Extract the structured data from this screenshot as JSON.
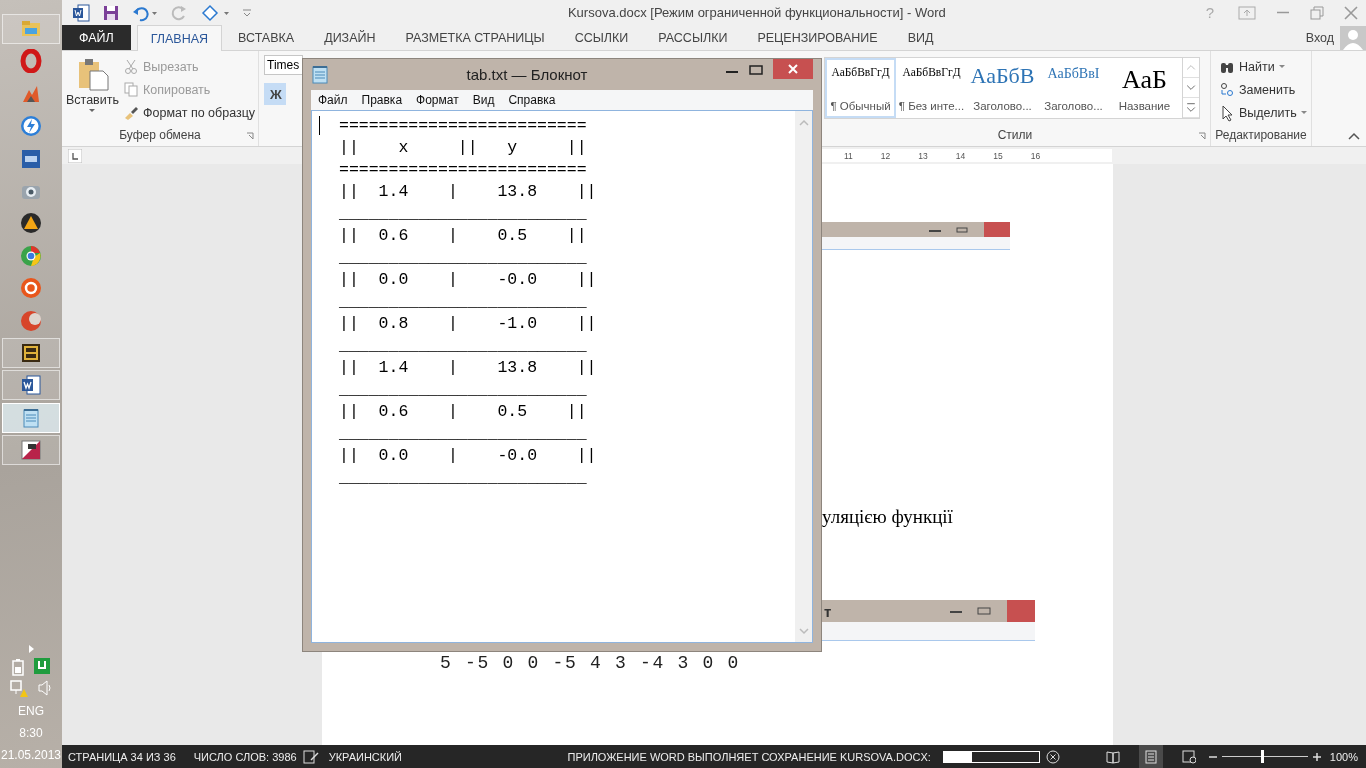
{
  "taskbar": {
    "items": [
      {
        "kind": "folder",
        "running": true,
        "selected": false
      },
      {
        "kind": "ring",
        "running": false,
        "selected": false
      },
      {
        "kind": "flame",
        "running": false,
        "selected": false
      },
      {
        "kind": "bolt",
        "running": false,
        "selected": false
      },
      {
        "kind": "tile",
        "running": false,
        "selected": false
      },
      {
        "kind": "camera",
        "running": false,
        "selected": false
      },
      {
        "kind": "triangle",
        "running": false,
        "selected": false
      },
      {
        "kind": "wheel",
        "running": false,
        "selected": false
      },
      {
        "kind": "swirl",
        "running": false,
        "selected": false
      },
      {
        "kind": "crescent",
        "running": false,
        "selected": false
      },
      {
        "kind": "box",
        "running": true,
        "selected": false
      },
      {
        "kind": "document",
        "running": true,
        "selected": false
      },
      {
        "kind": "notepad",
        "running": true,
        "selected": true
      },
      {
        "kind": "editor",
        "running": true,
        "selected": false
      }
    ],
    "tray": {
      "language": "ENG",
      "time": "8:30",
      "date": "21.05.2013"
    }
  },
  "word": {
    "title": "Kursova.docx [Режим ограниченной функциональности] - Word",
    "help_button": "?",
    "tabs": [
      {
        "label": "ФАЙЛ",
        "kind": "file",
        "selected": false
      },
      {
        "label": "ГЛАВНАЯ",
        "kind": "tab",
        "selected": true
      },
      {
        "label": "ВСТАВКА",
        "kind": "tab",
        "selected": false
      },
      {
        "label": "ДИЗАЙН",
        "kind": "tab",
        "selected": false
      },
      {
        "label": "РАЗМЕТКА СТРАНИЦЫ",
        "kind": "tab",
        "selected": false
      },
      {
        "label": "ССЫЛКИ",
        "kind": "tab",
        "selected": false
      },
      {
        "label": "РАССЫЛКИ",
        "kind": "tab",
        "selected": false
      },
      {
        "label": "РЕЦЕНЗИРОВАНИЕ",
        "kind": "tab",
        "selected": false
      },
      {
        "label": "ВИД",
        "kind": "tab",
        "selected": false
      }
    ],
    "account": "Вход",
    "ribbon": {
      "clipboard": {
        "paste": "Вставить",
        "title": "Буфер обмена",
        "items": [
          {
            "label": "Вырезать",
            "kind": "cut",
            "disabled": true
          },
          {
            "label": "Копировать",
            "kind": "copy",
            "disabled": true
          },
          {
            "label": "Формат по образцу",
            "kind": "brush",
            "disabled": false
          }
        ]
      },
      "font": {
        "name": "Times",
        "bold": {
          "label": "Ж",
          "selected": true
        }
      },
      "styles": {
        "title": "Стили",
        "items": [
          {
            "sample": "АаБбВвГгД",
            "label": "¶ Обычный",
            "kind": "body",
            "selected": true
          },
          {
            "sample": "АаБбВвГгД",
            "label": "¶ Без инте...",
            "kind": "body",
            "selected": false
          },
          {
            "sample": "АаБбВ",
            "label": "Заголово...",
            "kind": "heading1",
            "selected": false
          },
          {
            "sample": "АаБбВвI",
            "label": "Заголово...",
            "kind": "heading2",
            "selected": false
          },
          {
            "sample": "АаБ",
            "label": "Название",
            "kind": "title",
            "selected": false
          }
        ]
      },
      "editing": {
        "title": "Редактирование",
        "items": [
          {
            "label": "Найти",
            "kind": "find"
          },
          {
            "label": "Заменить",
            "kind": "replace"
          },
          {
            "label": "Выделить",
            "kind": "select"
          }
        ]
      }
    },
    "ruler": [
      "11",
      "12",
      "13",
      "14",
      "15",
      "16"
    ],
    "document": {
      "caption_fragment": "уляцією функції",
      "window_title_fragment": "т",
      "console_line": "5 -5 0 0 -5 4 3 -4 3 0 0"
    },
    "status_bar": {
      "page": "СТРАНИЦА 34 ИЗ 36",
      "words": "ЧИСЛО СЛОВ: 3986",
      "language": "УКРАИНСКИЙ",
      "saving": "ПРИЛОЖЕНИЕ WORD ВЫПОЛНЯЕТ СОХРАНЕНИЕ KURSOVA.DOCX:",
      "save_progress": {
        "level": 0.3
      },
      "views": [
        {
          "kind": "read",
          "selected": false
        },
        {
          "kind": "print",
          "selected": true
        },
        {
          "kind": "web",
          "selected": false
        }
      ],
      "zoom": {
        "level": 0.46,
        "reading": "100%"
      }
    }
  },
  "notepad": {
    "title": "tab.txt — Блокнот",
    "menu": [
      "Файл",
      "Правка",
      "Формат",
      "Вид",
      "Справка"
    ],
    "lines": [
      "=========================",
      "||    x     ||   y     ||",
      "=========================",
      "||  1.4    |    13.8    ||",
      "_________________________",
      "||  0.6    |    0.5    ||",
      "_________________________",
      "||  0.0    |    -0.0    ||",
      "_________________________",
      "||  0.8    |    -1.0    ||",
      "_________________________",
      "||  1.4    |    13.8    ||",
      "_________________________",
      "||  0.6    |    0.5    ||",
      "_________________________",
      "||  0.0    |    -0.0    ||",
      "_________________________"
    ]
  }
}
